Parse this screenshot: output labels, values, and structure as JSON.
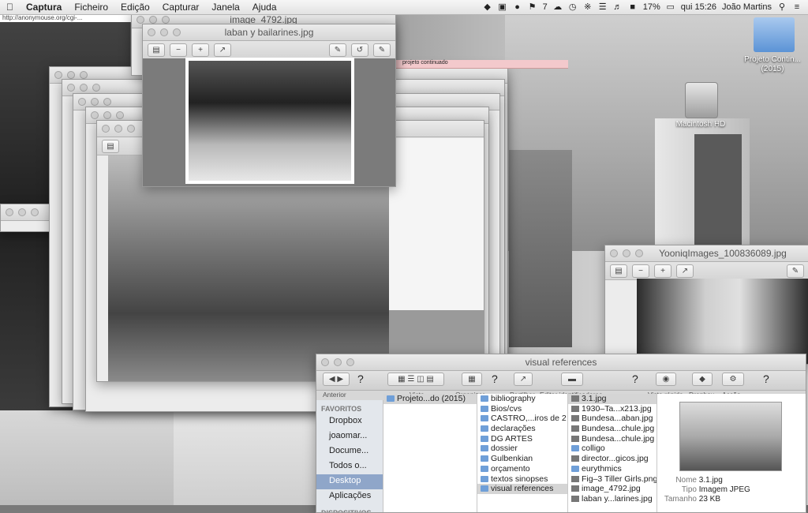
{
  "menubar": {
    "app": "Captura",
    "items": [
      "Ficheiro",
      "Edição",
      "Capturar",
      "Janela",
      "Ajuda"
    ],
    "status_battery": "17%",
    "status_flag": "7",
    "clock": "qui 15:26",
    "user": "João Martins"
  },
  "desktop": {
    "folder_label": "Projeto Contin...(2015)",
    "hd_label": "Macintosh HD",
    "sticky_note": "projeto continuado",
    "url_snippet": "http://anonymouse.org/cgi-..."
  },
  "windows": {
    "image4792_title": "image_4792.jpg",
    "laban_title": "laban y bailarines.jpg",
    "yooniq_title": "YooniqImages_100836089.jpg"
  },
  "finder": {
    "title": "visual references",
    "toolbar": [
      "Anterior",
      "Vista",
      "Organizar",
      "Partilhar",
      "Editar identificadores",
      "Vista rápida",
      "Dropbox",
      "Acção"
    ],
    "sidebar_heading": "FAVORITOS",
    "sidebar_items": [
      "Dropbox",
      "joaomar...",
      "Docume...",
      "Todos o...",
      "Desktop",
      "Aplicações"
    ],
    "sidebar_heading2": "DISPOSITIVOS",
    "col1": [
      "Projeto...do (2015)"
    ],
    "col2": [
      "bibliography",
      "Bios/cvs",
      "CASTRO,...iros de 2",
      "declarações",
      "DG ARTES",
      "dossier",
      "Gulbenkian",
      "orçamento",
      "textos sinopses",
      "visual references"
    ],
    "col3": [
      "3.1.jpg",
      "1930–Ta...x213.jpg",
      "Bundesa...aban.jpg",
      "Bundesa...chule.jpg",
      "Bundesa...chule.jpg",
      "colligo",
      "director...gicos.jpg",
      "eurythmics",
      "Fig–3 Tiller Girls.png",
      "image_4792.jpg",
      "laban y...larines.jpg"
    ],
    "info_labels": [
      "Nome",
      "Tipo",
      "Tamanho"
    ],
    "info_values": [
      "3.1.jpg",
      "Imagem JPEG",
      "23 KB"
    ]
  }
}
